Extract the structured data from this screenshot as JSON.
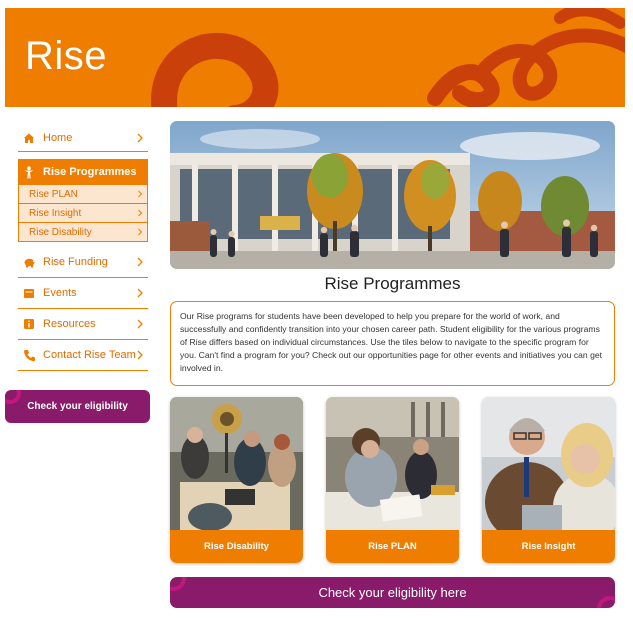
{
  "banner": {
    "title": "Rise"
  },
  "sidebar": {
    "items": [
      {
        "label": "Home",
        "icon": "home-icon"
      },
      {
        "label": "Rise Programmes",
        "icon": "person-icon"
      },
      {
        "label": "Rise Funding",
        "icon": "piggy-bank-icon"
      },
      {
        "label": "Events",
        "icon": "calendar-icon"
      },
      {
        "label": "Resources",
        "icon": "info-icon"
      },
      {
        "label": "Contact Rise Team",
        "icon": "phone-icon"
      }
    ],
    "sub_items": [
      {
        "label": "Rise PLAN"
      },
      {
        "label": "Rise Insight"
      },
      {
        "label": "Rise Disability"
      }
    ],
    "eligibility_label": "Check your eligibility"
  },
  "main": {
    "heading": "Rise Programmes",
    "intro": "Our Rise programs for students have been developed to help you prepare for the world of work, and successfully and confidently transition into your chosen career path. Student eligibility for the various programs of Rise differs based on individual circumstances. Use the tiles below to navigate to the specific program for you. Can't find a program for you? Check out our opportunities page for other events and initiatives you can get involved in.",
    "tiles": [
      {
        "label": "Rise Disability"
      },
      {
        "label": "Rise PLAN"
      },
      {
        "label": "Rise Insight"
      }
    ],
    "eligibility_label": "Check your eligibility here"
  },
  "colors": {
    "brand_orange": "#ef7d00",
    "accent_purple": "#8a1b6b",
    "swoosh_red": "#c9400a",
    "sub_item_bg": "#fde6cf"
  }
}
